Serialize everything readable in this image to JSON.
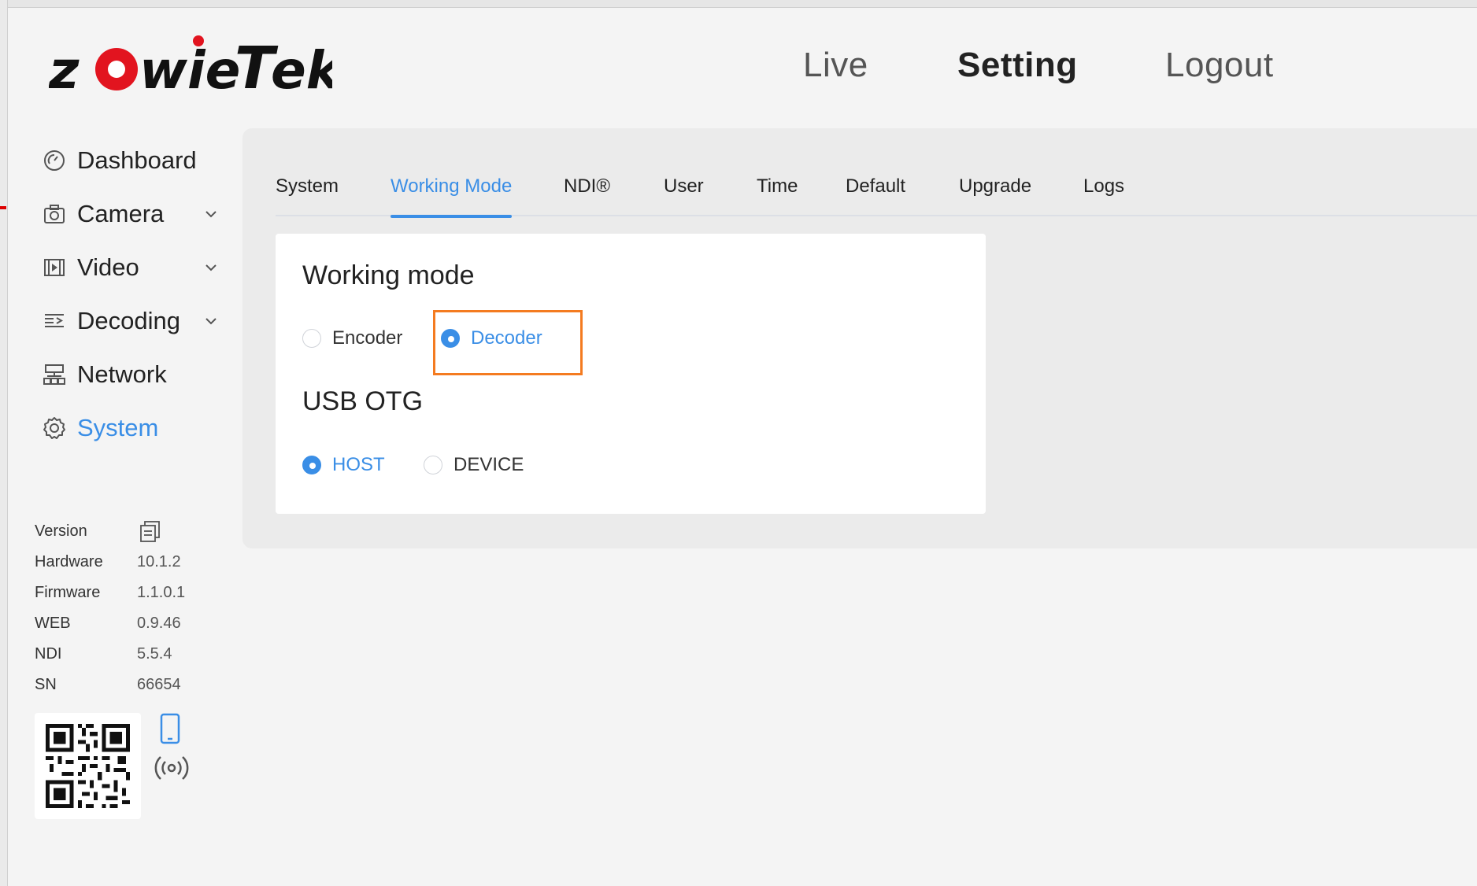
{
  "brand": {
    "logo_text": "zowieTek",
    "logo_colors": {
      "red": "#e2141f",
      "black": "#111111"
    }
  },
  "topnav": [
    {
      "label": "Live",
      "active": false
    },
    {
      "label": "Setting",
      "active": true
    },
    {
      "label": "Logout",
      "active": false
    }
  ],
  "sidebar": {
    "items": [
      {
        "label": "Dashboard",
        "icon": "gauge-icon",
        "has_chevron": false,
        "active": false
      },
      {
        "label": "Camera",
        "icon": "camera-icon",
        "has_chevron": true,
        "active": false
      },
      {
        "label": "Video",
        "icon": "film-icon",
        "has_chevron": true,
        "active": false
      },
      {
        "label": "Decoding",
        "icon": "decoding-icon",
        "has_chevron": true,
        "active": false
      },
      {
        "label": "Network",
        "icon": "network-icon",
        "has_chevron": false,
        "active": false
      },
      {
        "label": "System",
        "icon": "gear-icon",
        "has_chevron": false,
        "active": true
      }
    ]
  },
  "version": {
    "title": "Version",
    "rows": [
      {
        "key": "Hardware",
        "value": "10.1.2"
      },
      {
        "key": "Firmware",
        "value": "1.1.0.1"
      },
      {
        "key": "WEB",
        "value": "0.9.46"
      },
      {
        "key": "NDI",
        "value": "5.5.4"
      },
      {
        "key": "SN",
        "value": "66654"
      }
    ]
  },
  "tabs": [
    {
      "label": "System",
      "active": false
    },
    {
      "label": "Working Mode",
      "active": true
    },
    {
      "label": "NDI®",
      "active": false
    },
    {
      "label": "User",
      "active": false
    },
    {
      "label": "Time",
      "active": false
    },
    {
      "label": "Default",
      "active": false
    },
    {
      "label": "Upgrade",
      "active": false
    },
    {
      "label": "Logs",
      "active": false
    }
  ],
  "working_mode": {
    "title": "Working mode",
    "options": [
      {
        "label": "Encoder",
        "selected": false
      },
      {
        "label": "Decoder",
        "selected": true
      }
    ]
  },
  "usb_otg": {
    "title": "USB OTG",
    "options": [
      {
        "label": "HOST",
        "selected": true
      },
      {
        "label": "DEVICE",
        "selected": false
      }
    ]
  },
  "colors": {
    "accent": "#3a8ee6",
    "highlight": "#f47b20"
  }
}
